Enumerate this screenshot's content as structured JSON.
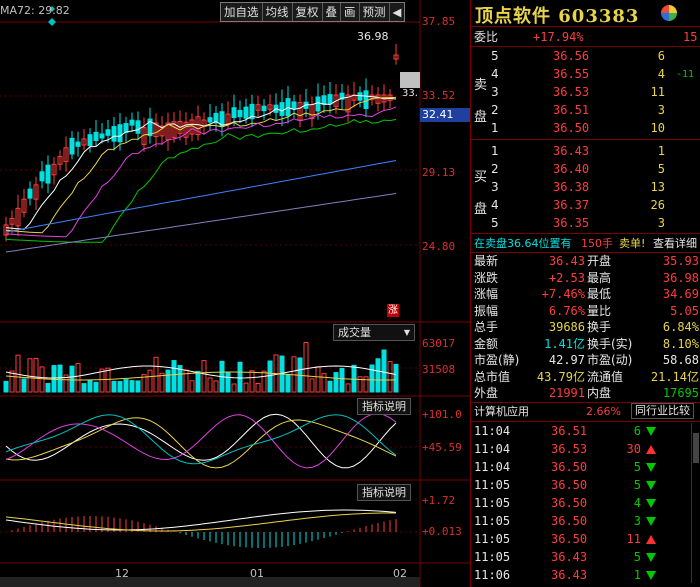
{
  "toolbar": {
    "items": [
      "加自选",
      "均线",
      "复权",
      "叠",
      "画",
      "预测"
    ],
    "arrow": "◀"
  },
  "chart": {
    "ma_label": "MA72: 29.82",
    "y_labels": [
      "37.85",
      "33.52",
      "32.41",
      "29.13",
      "24.80"
    ],
    "high_label": "36.98",
    "low_label": "33.",
    "zhang_badge": "涨",
    "volume_button": "成交量",
    "volume_labels": [
      "63017",
      "31508"
    ],
    "indicator_btn_1": "指标说明",
    "indicator_btn_2": "指标说明",
    "ind1_labels": [
      "+101.0",
      "+45.59"
    ],
    "ind2_labels": [
      "+1.72",
      "+0.013"
    ],
    "x_labels": [
      "12",
      "01",
      "02"
    ],
    "colors": {
      "up": "#ff3c3c",
      "down": "#00e0e0",
      "ma5": "#ffffff",
      "ma10": "#e8d44a",
      "ma20": "#e040e0",
      "ma30": "#00c800",
      "ma60": "#4080ff"
    }
  },
  "quote": {
    "name": "顶点软件",
    "code": "603383",
    "weibi_label": "委比",
    "weibi_value": "+17.94%",
    "weibi_extra": "15",
    "sell_side_label": [
      "卖",
      "盘"
    ],
    "buy_side_label": [
      "买",
      "盘"
    ],
    "sell": [
      {
        "lvl": "5",
        "price": "36.56",
        "vol": "6",
        "chg": ""
      },
      {
        "lvl": "4",
        "price": "36.55",
        "vol": "4",
        "chg": "-11"
      },
      {
        "lvl": "3",
        "price": "36.53",
        "vol": "11",
        "chg": ""
      },
      {
        "lvl": "2",
        "price": "36.51",
        "vol": "3",
        "chg": ""
      },
      {
        "lvl": "1",
        "price": "36.50",
        "vol": "10",
        "chg": ""
      }
    ],
    "buy": [
      {
        "lvl": "1",
        "price": "36.43",
        "vol": "1"
      },
      {
        "lvl": "2",
        "price": "36.40",
        "vol": "5"
      },
      {
        "lvl": "3",
        "price": "36.38",
        "vol": "13"
      },
      {
        "lvl": "4",
        "price": "36.37",
        "vol": "26"
      },
      {
        "lvl": "5",
        "price": "36.35",
        "vol": "3"
      }
    ],
    "order_bar": {
      "text": "在卖盘36.64位置有",
      "hands": "150手",
      "sell_single": "卖单!",
      "view": "查看详细"
    },
    "stats": [
      {
        "l1": "最新",
        "v1": "36.43",
        "c1": "red",
        "l2": "开盘",
        "v2": "35.93",
        "c2": "red"
      },
      {
        "l1": "涨跌",
        "v1": "+2.53",
        "c1": "red",
        "l2": "最高",
        "v2": "36.98",
        "c2": "red"
      },
      {
        "l1": "涨幅",
        "v1": "+7.46%",
        "c1": "red",
        "l2": "最低",
        "v2": "34.69",
        "c2": "red"
      },
      {
        "l1": "振幅",
        "v1": "6.76%",
        "c1": "red",
        "l2": "量比",
        "v2": "5.05",
        "c2": "red"
      },
      {
        "l1": "总手",
        "v1": "39686",
        "c1": "yellow",
        "l2": "换手",
        "v2": "6.84%",
        "c2": "yellow"
      },
      {
        "l1": "金额",
        "v1": "1.41亿",
        "c1": "cyan",
        "l2": "换手(实)",
        "v2": "8.10%",
        "c2": "yellow"
      },
      {
        "l1": "市盈(静)",
        "v1": "42.97",
        "c1": "white",
        "l2": "市盈(动)",
        "v2": "58.68",
        "c2": "white"
      },
      {
        "l1": "总市值",
        "v1": "43.79亿",
        "c1": "yellow",
        "l2": "流通值",
        "v2": "21.14亿",
        "c2": "yellow"
      },
      {
        "l1": "外盘",
        "v1": "21991",
        "c1": "red",
        "l2": "内盘",
        "v2": "17695",
        "c2": "green"
      }
    ],
    "sector": {
      "name": "计算机应用",
      "pct": "2.66%",
      "btn": "同行业比较"
    },
    "ticks": [
      {
        "t": "11:04",
        "p": "36.51",
        "v": "6",
        "dir": "down"
      },
      {
        "t": "11:04",
        "p": "36.53",
        "v": "30",
        "dir": "up"
      },
      {
        "t": "11:04",
        "p": "36.50",
        "v": "5",
        "dir": "down"
      },
      {
        "t": "11:05",
        "p": "36.50",
        "v": "5",
        "dir": "down"
      },
      {
        "t": "11:05",
        "p": "36.50",
        "v": "4",
        "dir": "down"
      },
      {
        "t": "11:05",
        "p": "36.50",
        "v": "3",
        "dir": "down"
      },
      {
        "t": "11:05",
        "p": "36.50",
        "v": "11",
        "dir": "up"
      },
      {
        "t": "11:05",
        "p": "36.43",
        "v": "5",
        "dir": "down"
      },
      {
        "t": "11:06",
        "p": "36.43",
        "v": "1",
        "dir": "down"
      }
    ]
  }
}
